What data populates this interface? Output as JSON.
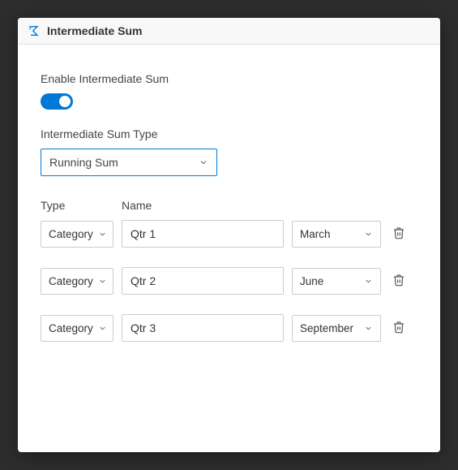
{
  "header": {
    "title": "Intermediate Sum"
  },
  "form": {
    "enable_label": "Enable Intermediate Sum",
    "type_label": "Intermediate Sum Type",
    "type_value": "Running Sum",
    "columns": {
      "type": "Type",
      "name": "Name"
    },
    "rows": [
      {
        "type": "Category",
        "name": "Qtr 1",
        "month": "March"
      },
      {
        "type": "Category",
        "name": "Qtr 2",
        "month": "June"
      },
      {
        "type": "Category",
        "name": "Qtr 3",
        "month": "September"
      }
    ]
  }
}
